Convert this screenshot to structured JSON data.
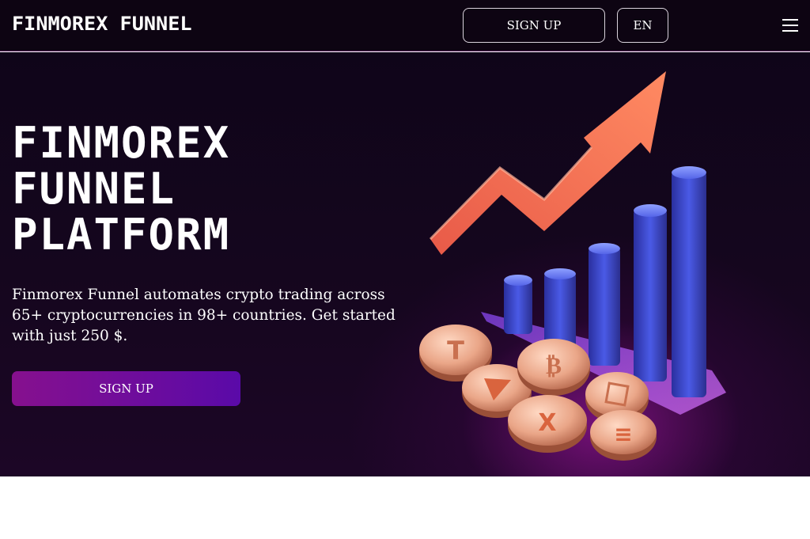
{
  "header": {
    "logo": "FINMOREX FUNNEL",
    "signup_label": "SIGN UP",
    "language": "EN",
    "menu_icon": "hamburger-icon"
  },
  "hero": {
    "title_lines": [
      "FINMOREX",
      "FUNNEL",
      "PLATFORM"
    ],
    "description": "Finmorex Funnel automates crypto trading across 65+ cryptocurrencies in 98+ countries. Get started with just 250 $.",
    "cta_label": "SIGN UP",
    "illustration": "crypto-growth-chart-illustration",
    "coin_icons": [
      "tether-coin-icon",
      "tron-coin-icon",
      "bitcoin-coin-icon",
      "ripple-coin-icon",
      "binance-coin-icon",
      "solana-coin-icon"
    ]
  },
  "colors": {
    "background": "#0d0412",
    "accent_gradient_start": "#86108e",
    "accent_gradient_end": "#5a0aa8",
    "header_border": "#5a1f5c",
    "arrow": "#f07050",
    "bars": "#3b4bd6",
    "coins": "#e8a585"
  }
}
